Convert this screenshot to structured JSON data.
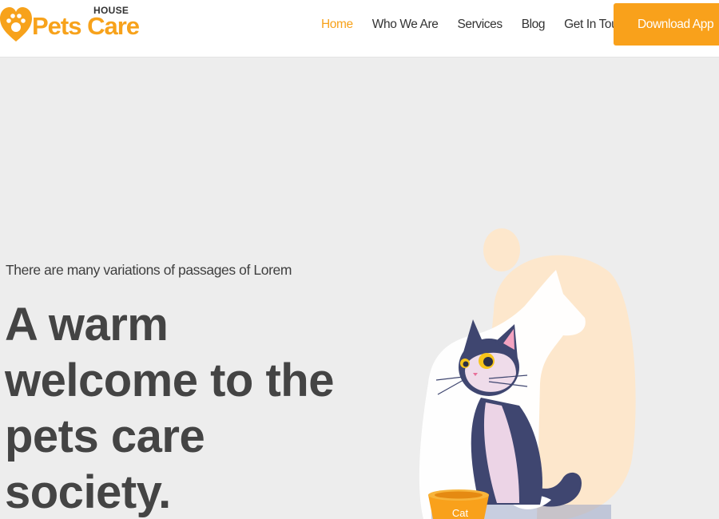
{
  "brand": {
    "house_label": "HOUSE",
    "name": "Pets Care",
    "accent_color": "#f7a21b",
    "logo_icon": "heart-paw-icon"
  },
  "nav": {
    "items": [
      {
        "label": "Home",
        "active": true
      },
      {
        "label": "Who We Are",
        "active": false
      },
      {
        "label": "Services",
        "active": false
      },
      {
        "label": "Blog",
        "active": false
      },
      {
        "label": "Get In Touch",
        "active": false
      }
    ],
    "cta_label": "Download App"
  },
  "hero": {
    "subtitle": "There are many variations of passages of Lorem",
    "headline": "A warm welcome to the pets care society.",
    "illustration": {
      "icon": "cat-illustration",
      "bowl_label": "Cat"
    }
  }
}
